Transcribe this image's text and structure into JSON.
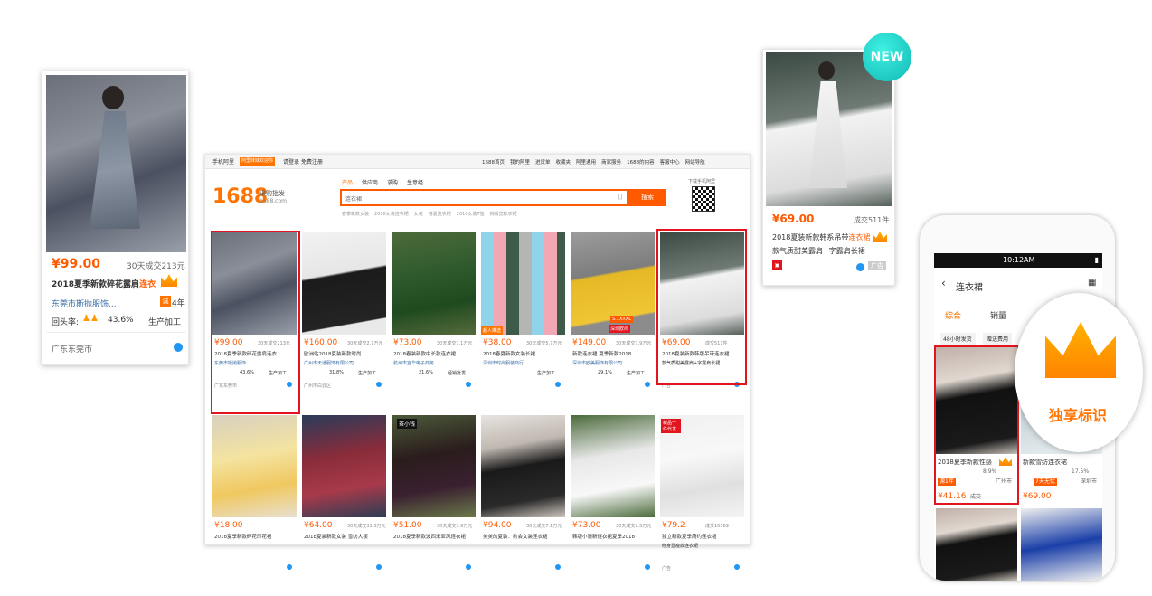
{
  "left_card": {
    "price": "¥99.00",
    "sales": "30天成交213元",
    "title_prefix": "2018夏季新款碎花露肩",
    "title_hl": "连衣",
    "shop": "东莞市斯抛服饰...",
    "years": "4年",
    "repurchase_label": "回头率:",
    "repurchase": "43.6%",
    "type": "生产加工",
    "location": "广东东莞市"
  },
  "site": {
    "top_left_link": "手机阿里",
    "top_badge": "阿里妹妹欢迎你",
    "login": "请登录",
    "register": "免费注册",
    "top_nav": [
      "1688首页",
      "我的阿里",
      "进货单",
      "收藏夹",
      "阿里通用",
      "商家服务",
      "1688的内容",
      "客服中心",
      "网站导航"
    ],
    "logo_num": "1688",
    "logo_text": "采购批发",
    "logo_url": "1688.com",
    "search_tabs": [
      "产品",
      "供应商",
      "求购",
      "生意经"
    ],
    "search_placeholder": "连衣裙",
    "search_button": "搜索",
    "hot_words": [
      "春季新款女装",
      "2018女装连衣裙",
      "女装",
      "春夏连衣裙",
      "2018女装T恤",
      "韩版宽松衣裙"
    ],
    "qr_label": "下载手机阿里"
  },
  "grid_row1": [
    {
      "price": "¥99.00",
      "sales": "30天成交213元",
      "title": "2018夏季新款碎花露肩连衣",
      "shop": "东莞市斯抛服饰",
      "repurchase": "43.6%",
      "type": "生产加工",
      "location": "广东东莞市"
    },
    {
      "price": "¥160.00",
      "sales": "30天成交2.7万元",
      "title": "欧洲站2018夏装新款时尚",
      "shop": "广州市天通服饰有限公司",
      "repurchase": "31.8%",
      "type": "生产加工",
      "location": "广州市白云区"
    },
    {
      "price": "¥73.00",
      "sales": "30天成交7.1万元",
      "title": "2018春装新款中长款连衣裙",
      "shop": "杭州市宜华电子商务",
      "repurchase": "21.6%",
      "type": "经销批发",
      "location": ""
    },
    {
      "price": "¥38.00",
      "sales": "30天成交5.7万元",
      "title": "2018春夏新款女装长裙",
      "shop": "深圳市时尚服装商行",
      "repurchase": "",
      "type": "生产加工",
      "location": ""
    },
    {
      "price": "¥149.00",
      "sales": "30天成交7.9万元",
      "title": "新款连衣裙 夏季新款2018",
      "shop": "深圳市欧美服饰有限公司",
      "repurchase": "29.1%",
      "type": "生产加工",
      "location": ""
    },
    {
      "price": "¥69.00",
      "sales": "成交511件",
      "title": "2018夏装新款韩版吊带连衣裙",
      "desc": "款气质甜美露肩+字露肩长裙",
      "location": "广告"
    }
  ],
  "grid_row1_badges": [
    "超人推选",
    "S...XXXL",
    "深圳欧尚"
  ],
  "grid_row2": [
    {
      "price": "¥18.00",
      "title": "2018夏季新款碎花印花裙"
    },
    {
      "price": "¥64.00",
      "sales": "30天成交31.3万元",
      "title": "2018夏装新款女装 雪纺大摆"
    },
    {
      "price": "¥51.00",
      "sales": "30天成交3.9万元",
      "title": "2018夏季新款波西米亚风连衣裙"
    },
    {
      "price": "¥94.00",
      "sales": "30天成交7.1万元",
      "title": "美美的夏装：约会女装连衣裙"
    },
    {
      "price": "¥73.00",
      "sales": "30天成交2.5万元",
      "title": "韩版小清新连衣裙夏季2018"
    },
    {
      "price": "¥79.2",
      "sales": "成交10569",
      "title": "独立新款夏季简约连衣裙",
      "desc": "修身显瘦款连衣裙",
      "location": "广告"
    }
  ],
  "grid_row2_badges": [
    "茶小钱",
    "新品一件代发"
  ],
  "right_card": {
    "new_badge": "NEW",
    "price": "¥69.00",
    "sales": "成交511件",
    "title_prefix": "2018夏装新款韩系吊带",
    "title_hl": "连衣裙",
    "desc": "款气质甜美露肩+字露肩长裙",
    "ad": "广告"
  },
  "phone": {
    "time": "10:12AM",
    "search_query": "连衣裙",
    "tabs": [
      "综合",
      "销量"
    ],
    "filters": [
      "48小时发货",
      "赠送费用"
    ],
    "item1": {
      "title": "2018夏季新款性感",
      "price": "¥41.16",
      "repurchase": "8.9%",
      "location": "广州市",
      "sales": "成交",
      "tag": "源1年"
    },
    "item2": {
      "title": "新款雪纺连衣裙",
      "price": "¥69.00",
      "repurchase": "17.5%",
      "location": "深圳市",
      "tag": "7天无忧"
    },
    "callout": "独享标识"
  }
}
